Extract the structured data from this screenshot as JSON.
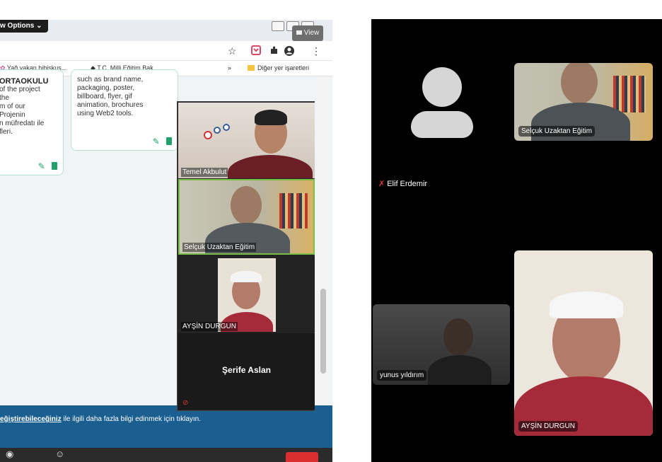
{
  "browser": {
    "view_options_label": "w Options ⌄",
    "view_button_label": "View",
    "bookmarks": [
      "Yağ yakan hibiskus...",
      "T.C. Milli Eğitim Bak...",
      "»",
      "Diğer yer işaretleri"
    ]
  },
  "cards": {
    "card1": {
      "title": "ORTAOKULU",
      "body": "of the project\nthe\nm of our\nProjenin\nn müfredatı ile\nfleri."
    },
    "card2": {
      "body": "such as brand name,\npackaging, poster,\nbillboard, flyer, gif\nanimation, brochures\nusing Web2 tools."
    }
  },
  "banner": {
    "link_text": "eğiştirebileceğiniz",
    "rest_text": " ile ilgili daha fazla bilgi edinmek için tıklayın."
  },
  "gallery": {
    "participants": [
      {
        "name": "Temel Akbulut"
      },
      {
        "name": "Selçuk Uzaktan Eğitim"
      },
      {
        "name": "AYŞİN DURGUN"
      },
      {
        "name": "Şerife Aslan"
      }
    ]
  },
  "mobile": {
    "participants": [
      {
        "name": "Elif Erdemir",
        "muted": true
      },
      {
        "name": "Selçuk Uzaktan Eğitim"
      },
      {
        "name": "yunus yıldırım"
      },
      {
        "name": "AYŞİN DURGUN"
      }
    ]
  },
  "icons": {
    "star": "☆",
    "menu": "⋮",
    "mic_muted": "🎤"
  },
  "colors": {
    "banner": "#1b5f91",
    "gallery_bg": "#232323",
    "mobile_bg": "#000000",
    "leave_red": "#d92f2f",
    "card_border": "#b6e3cd"
  }
}
